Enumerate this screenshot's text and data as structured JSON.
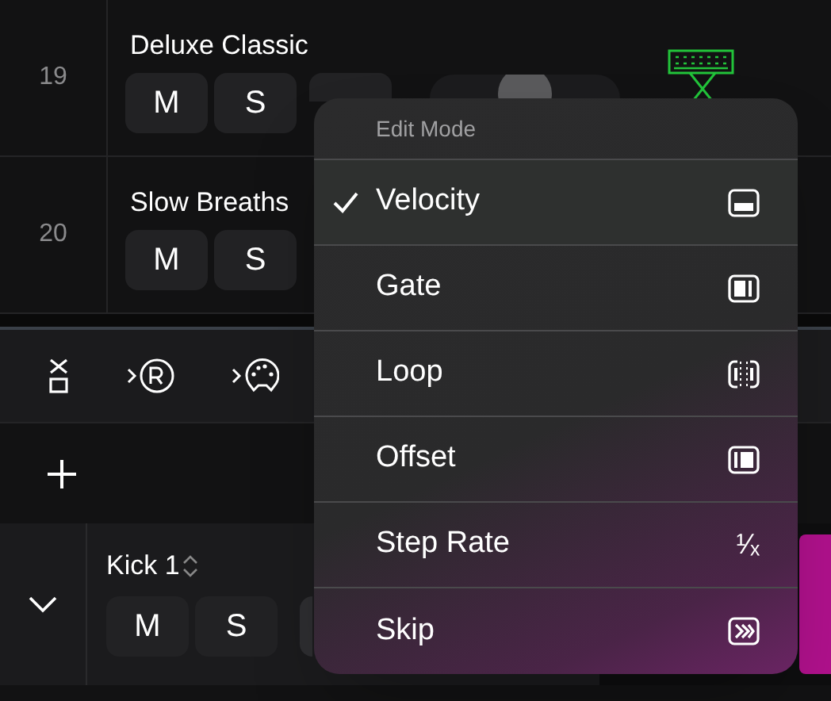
{
  "tracks": [
    {
      "number": "19",
      "name": "Deluxe Classic",
      "buttons": [
        "M",
        "S"
      ],
      "partial_button": true,
      "slider": {
        "level": 0.5
      }
    },
    {
      "number": "20",
      "name": "Slow Breaths",
      "buttons": [
        "M",
        "S"
      ],
      "partial_button": false
    }
  ],
  "pattern_track": {
    "name": "Kick 1",
    "buttons": [
      "M",
      "S"
    ],
    "expanded": true
  },
  "menu": {
    "title": "Edit Mode",
    "items": [
      {
        "label": "Velocity",
        "selected": true,
        "kind": "velocity"
      },
      {
        "label": "Gate",
        "selected": false,
        "kind": "gate"
      },
      {
        "label": "Loop",
        "selected": false,
        "kind": "loop"
      },
      {
        "label": "Offset",
        "selected": false,
        "kind": "offset"
      },
      {
        "label": "Step Rate",
        "selected": false,
        "kind": "fraction",
        "symbol": "¹⁄ₓ"
      },
      {
        "label": "Skip",
        "selected": false,
        "kind": "skip"
      }
    ]
  }
}
